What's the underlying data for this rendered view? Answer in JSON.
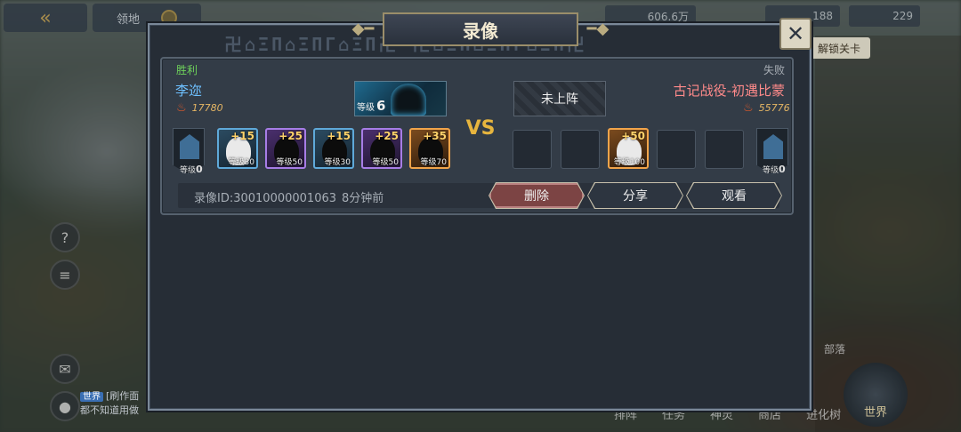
{
  "hud": {
    "back_icon": "back-arrow-icon",
    "territory_label": "领地",
    "resources": [
      "606.6万",
      "188",
      "229"
    ],
    "unlock_label": "解锁关卡",
    "chat_tag": "世界",
    "chat_line1": "[刷作面",
    "chat_line2": "都不知道用做",
    "bottom_tabs": [
      "排阵",
      "任务",
      "神灵",
      "商店",
      "进化树"
    ],
    "world_label": "世界",
    "tribe_label": "部落"
  },
  "dialog": {
    "title": "录像",
    "close_icon": "close-x-icon"
  },
  "record": {
    "left": {
      "result": "胜利",
      "name": "李迩",
      "power": "17780",
      "leader_level_label": "等级",
      "leader_level": "6",
      "banner_level_label": "等级",
      "banner_level": "0",
      "heroes": [
        {
          "rarity": "blue",
          "stars": "+15",
          "level": "等级30"
        },
        {
          "rarity": "purple",
          "stars": "+25",
          "level": "等级50"
        },
        {
          "rarity": "blue",
          "stars": "+15",
          "level": "等级30"
        },
        {
          "rarity": "purple",
          "stars": "+25",
          "level": "等级50"
        },
        {
          "rarity": "orange",
          "stars": "+35",
          "level": "等级70"
        }
      ]
    },
    "vs_label": "VS",
    "right": {
      "result": "失败",
      "name": "古记战役-初遇比蒙",
      "power": "55776",
      "leader_empty_label": "未上阵",
      "banner_level_label": "等级",
      "banner_level": "0",
      "heroes": [
        {
          "rarity": "orange",
          "stars": "+50",
          "level": "等级100"
        }
      ]
    },
    "id_text": "录像ID:30010000001063",
    "time_text": "8分钟前",
    "actions": {
      "delete": "删除",
      "share": "分享",
      "watch": "观看"
    }
  },
  "colors": {
    "win": "#6fd35b",
    "lose_name": "#ff8a8a",
    "left_name": "#6ec0ff",
    "power": "#e4b564",
    "vs": "#e7b53e"
  }
}
